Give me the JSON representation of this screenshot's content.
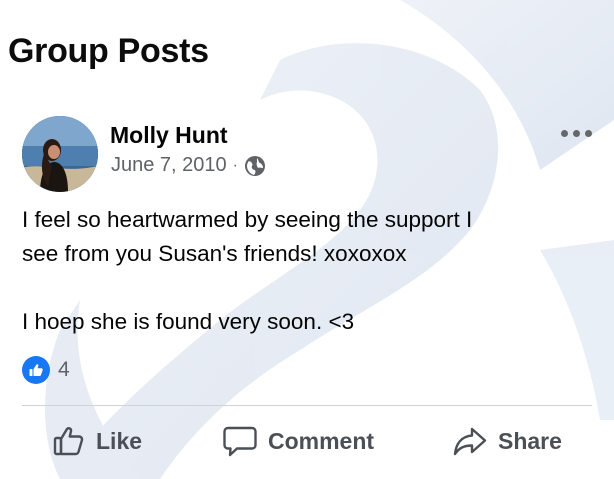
{
  "page": {
    "title": "Group Posts"
  },
  "post": {
    "author": "Molly Hunt",
    "date": "June 7, 2010",
    "separator": "·",
    "privacy_icon": "globe-icon",
    "body": [
      "I feel so heartwarmed by seeing the support I",
      "see from you Susan's friends! xoxoxox",
      "",
      "I hoep she is found very soon. <3"
    ],
    "reactions": {
      "type": "like",
      "count": "4"
    }
  },
  "actions": {
    "like_label": "Like",
    "comment_label": "Comment",
    "share_label": "Share"
  },
  "colors": {
    "like_blue": "#1877f2",
    "meta_gray": "#5f6368",
    "action_gray": "#4b4f56",
    "watermark": "#c8d3e6"
  }
}
